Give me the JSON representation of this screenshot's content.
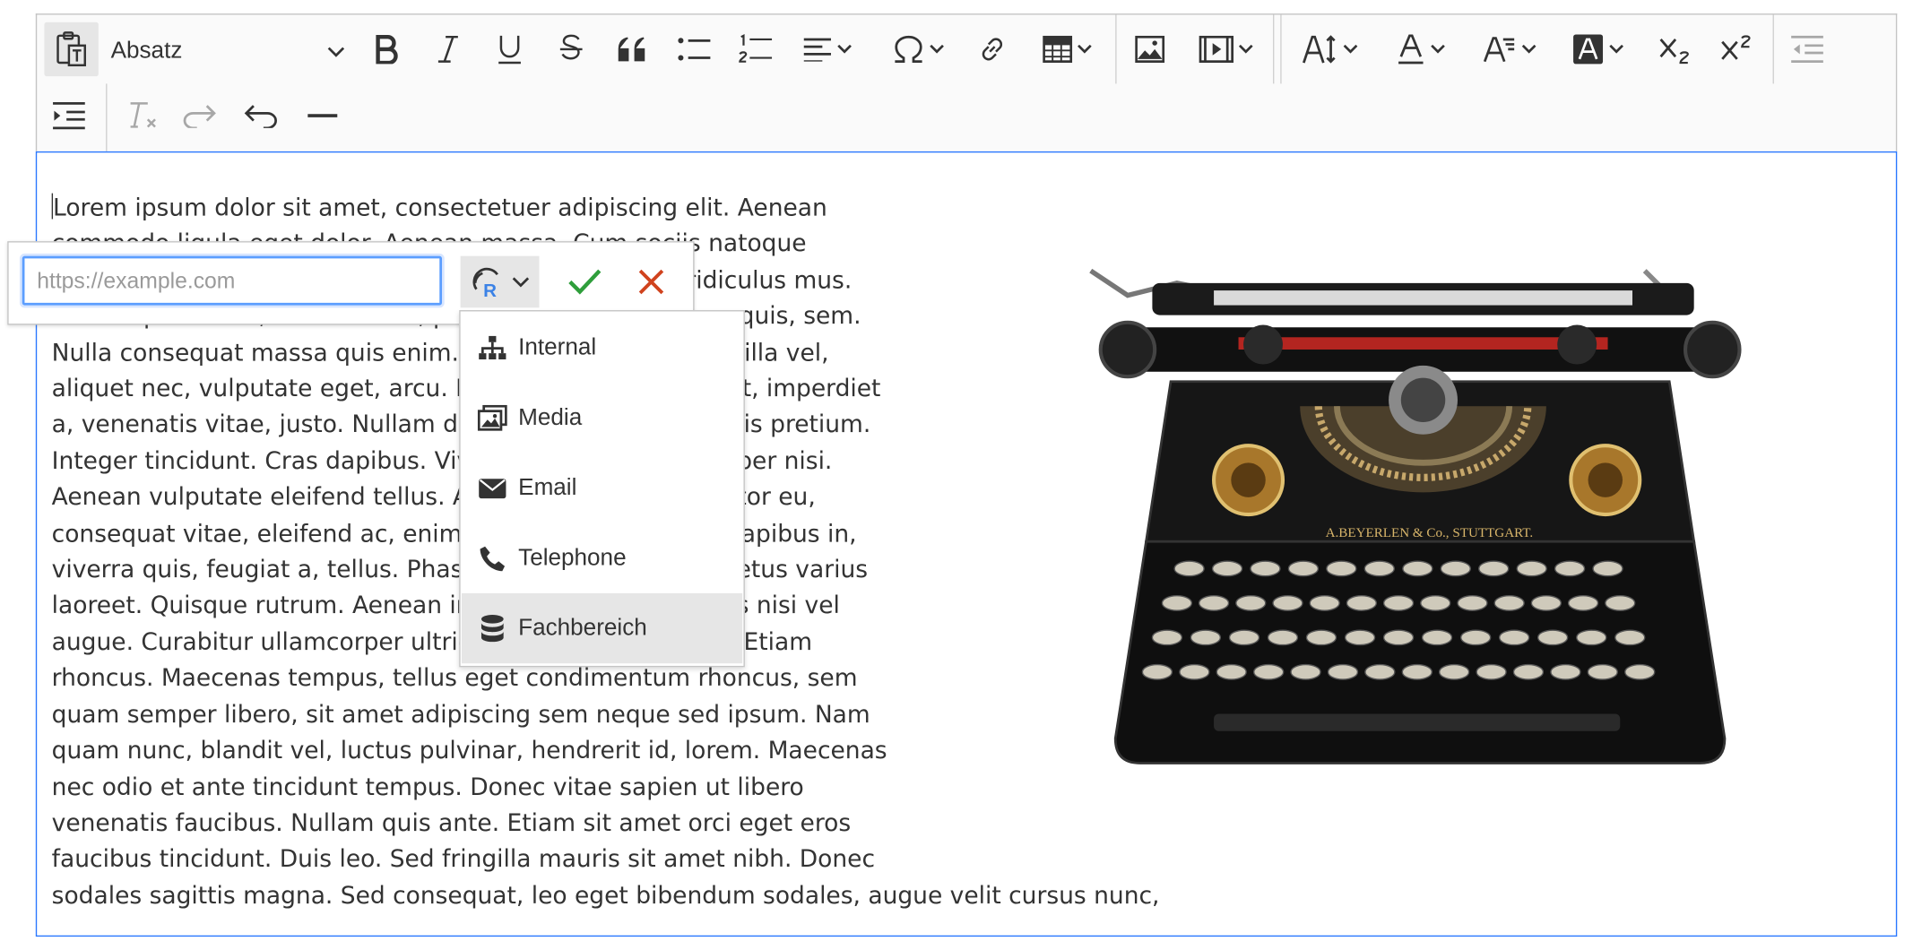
{
  "toolbar": {
    "heading_value": "Absatz",
    "buttons": [
      "paste-as-plain-text-icon",
      "bold-icon",
      "italic-icon",
      "underline-icon",
      "strikethrough-icon",
      "blockquote-icon",
      "bulleted-list-icon",
      "numbered-list-icon",
      "alignment-icon",
      "special-characters-icon",
      "link-icon",
      "table-icon",
      "image-icon",
      "media-icon",
      "font-size-icon",
      "font-color-icon",
      "font-family-icon",
      "font-background-color-icon",
      "subscript-icon",
      "superscript-icon",
      "outdent-icon",
      "indent-icon",
      "remove-format-icon",
      "redo-icon",
      "undo-icon",
      "horizontal-line-icon"
    ]
  },
  "content": {
    "lines": [
      "Lorem ipsum dolor sit amet, consectetuer adipiscing elit. Aenean",
      "commodo ligula eget dolor. Aenean massa. Cum sociis natoque",
      "penatibus et magnis dis parturient montes, nascetur ridiculus mus.",
      "Donec quam felis, ultricies nec, pellentesque eu, pretium quis, sem.",
      "Nulla consequat massa quis enim. Donec pede justo, fringilla vel,",
      "aliquet nec, vulputate eget, arcu. In enim justo, rhoncus ut, imperdiet",
      "a, venenatis vitae, justo. Nullam dictum felis eu pede mollis pretium.",
      "Integer tincidunt. Cras dapibus. Vivamus elementum semper nisi.",
      "Aenean vulputate eleifend tellus. Aenean leo ligula, porttitor eu,",
      "consequat vitae, eleifend ac, enim. Aliquam lorem ante, dapibus in,",
      "viverra quis, feugiat a, tellus. Phasellus viverra nulla ut metus varius",
      "laoreet. Quisque rutrum. Aenean imperdiet. Etiam ultricies nisi vel",
      "augue. Curabitur ullamcorper ultricies nisi. Nam eget dui. Etiam",
      "rhoncus. Maecenas tempus, tellus eget condimentum rhoncus, sem",
      "quam semper libero, sit amet adipiscing sem neque sed ipsum. Nam",
      "quam nunc, blandit vel, luctus pulvinar, hendrerit id, lorem. Maecenas",
      "nec odio et ante tincidunt tempus. Donec vitae sapien ut libero",
      "venenatis faucibus. Nullam quis ante. Etiam sit amet orci eget eros",
      "faucibus tincidunt. Duis leo. Sed fringilla mauris sit amet nibh. Donec",
      "sodales sagittis magna. Sed consequat, leo eget bibendum sodales, augue velit cursus nunc,"
    ],
    "image_engraving": "A.BEYERLEN & Co., STUTTGART."
  },
  "link_balloon": {
    "url_value": "",
    "url_placeholder": "https://example.com"
  },
  "link_types": {
    "items": [
      {
        "label": "Internal",
        "icon": "sitemap-icon"
      },
      {
        "label": "Media",
        "icon": "images-icon"
      },
      {
        "label": "Email",
        "icon": "envelope-icon"
      },
      {
        "label": "Telephone",
        "icon": "phone-icon"
      },
      {
        "label": "Fachbereich",
        "icon": "database-icon"
      }
    ],
    "highlighted": "Fachbereich"
  },
  "colors": {
    "focus_border": "#2977ff",
    "save_check": "#2f9e3b",
    "cancel_x": "#d0431e",
    "link_icon_accent": "#3b82e6"
  }
}
